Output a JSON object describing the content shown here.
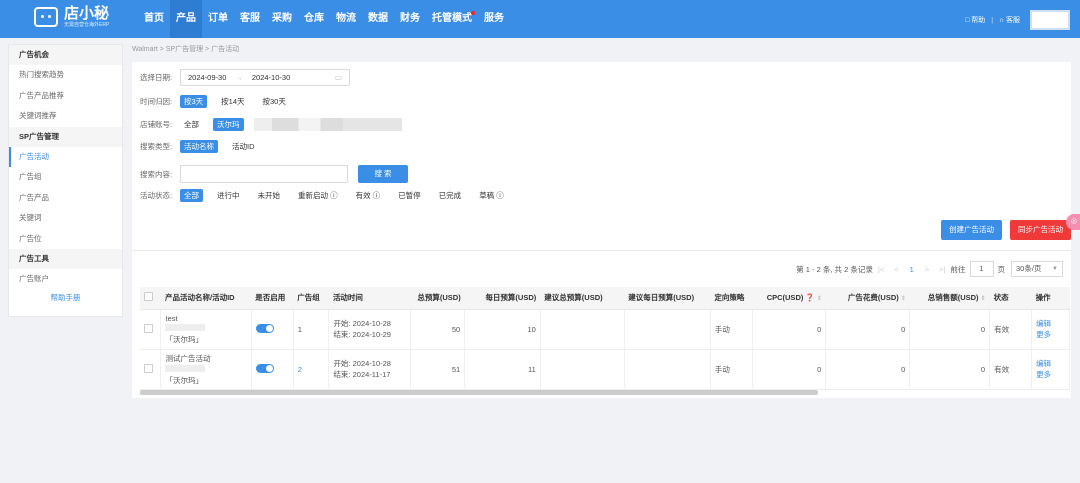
{
  "brand": {
    "name": "店小秘",
    "subtitle": "无需自营仓海外ERP"
  },
  "nav": {
    "items": [
      {
        "label": "首页"
      },
      {
        "label": "产品",
        "active": true
      },
      {
        "label": "订单"
      },
      {
        "label": "客服"
      },
      {
        "label": "采购"
      },
      {
        "label": "仓库"
      },
      {
        "label": "物流"
      },
      {
        "label": "数据"
      },
      {
        "label": "财务"
      },
      {
        "label": "托管模式",
        "badge": true
      },
      {
        "label": "服务"
      }
    ],
    "help": "帮助",
    "service": "客服"
  },
  "sidebar": {
    "groups": [
      {
        "title": "广告机会",
        "items": [
          "热门搜索趋势",
          "广告产品推荐",
          "关键词推荐"
        ]
      },
      {
        "title": "SP广告管理",
        "items": [
          "广告活动",
          "广告组",
          "广告产品",
          "关键词",
          "广告位"
        ]
      },
      {
        "title": "广告工具",
        "items": [
          "广告账户"
        ]
      }
    ],
    "active": "广告活动",
    "help_link": "帮助手册"
  },
  "breadcrumb": "Walmart > SP广告管理 > 广告活动",
  "filters": {
    "date_label": "选择日期:",
    "date_start": "2024-09-30",
    "date_sep": "→",
    "date_end": "2024-10-30",
    "time_label": "时间归因:",
    "time_options": [
      "按3天",
      "按14天",
      "按30天"
    ],
    "shop_label": "店铺账号:",
    "shop_options": [
      "全部",
      "沃尔玛"
    ],
    "search_type_label": "搜索类型:",
    "search_type_options": [
      "活动名称",
      "活动ID"
    ],
    "content_label": "搜索内容:",
    "search_btn": "搜 索",
    "status_label": "活动状态:",
    "status_options": [
      "全部",
      "进行中",
      "未开始",
      "重新启动 ⓘ",
      "有效 ⓘ",
      "已暂停",
      "已完成",
      "草稿 ⓘ"
    ]
  },
  "actions": {
    "create": "创建广告活动",
    "sync": "同步广告活动"
  },
  "pager": {
    "summary": "第 1 - 2 条, 共 2 条记录",
    "page": "1",
    "goto_label": "前往",
    "goto_value": "1",
    "page_unit": "页",
    "page_size": "30条/页"
  },
  "table": {
    "headers": [
      "产品活动名称/活动ID",
      "是否启用",
      "广告组",
      "活动时间",
      "总预算(USD)",
      "每日预算(USD)",
      "建议总预算(USD)",
      "建议每日预算(USD)",
      "定向策略",
      "CPC(USD) ❓",
      "广告花费(USD)",
      "总销售额(USD)",
      "状态",
      "操作"
    ],
    "rows": [
      {
        "name": "test",
        "shop": "「沃尔玛」",
        "groups": "1",
        "start": "开始:  2024-10-28",
        "end": "结束:  2024-10-29",
        "total_budget": "50",
        "daily_budget": "10",
        "strategy": "手动",
        "cpc": "0",
        "spend": "0",
        "sales": "0",
        "status": "有效",
        "edit": "编辑",
        "more": "更多"
      },
      {
        "name": "测试广告活动",
        "shop": "「沃尔玛」",
        "groups": "2",
        "start": "开始:  2024-10-28",
        "end": "结束:  2024-11-17",
        "total_budget": "51",
        "daily_budget": "11",
        "strategy": "手动",
        "cpc": "0",
        "spend": "0",
        "sales": "0",
        "status": "有效",
        "edit": "编辑",
        "more": "更多"
      }
    ]
  }
}
